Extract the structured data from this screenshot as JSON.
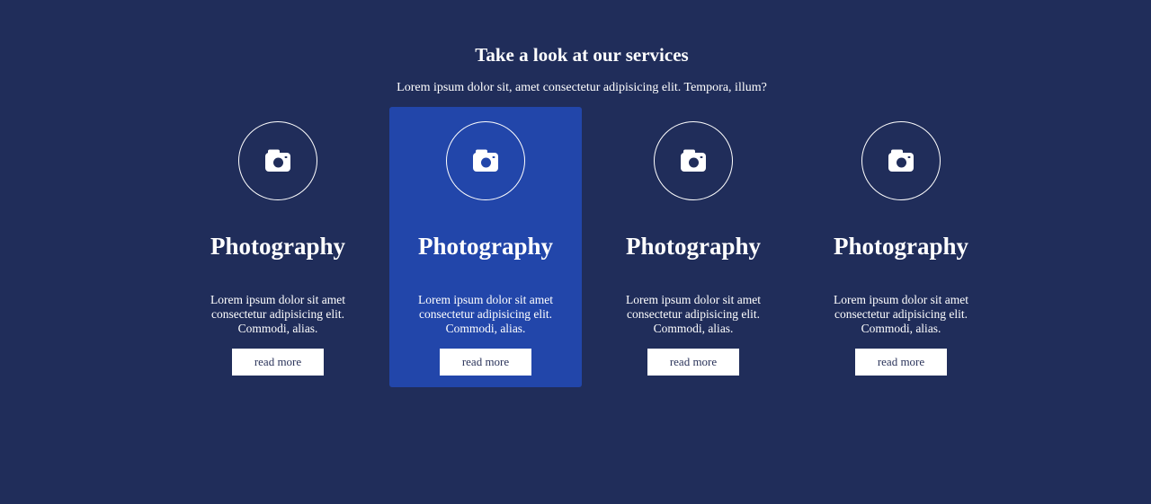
{
  "header": {
    "title": "Take a look at our services",
    "subtitle": "Lorem ipsum dolor sit, amet consectetur adipisicing elit. Tempora, illum?"
  },
  "cards": [
    {
      "icon": "camera-icon",
      "title": "Photography",
      "text": "Lorem ipsum dolor sit amet consectetur adipisicing elit. Commodi, alias.",
      "button": "read more"
    },
    {
      "icon": "camera-icon",
      "title": "Photography",
      "text": "Lorem ipsum dolor sit amet consectetur adipisicing elit. Commodi, alias.",
      "button": "read more"
    },
    {
      "icon": "camera-icon",
      "title": "Photography",
      "text": "Lorem ipsum dolor sit amet consectetur adipisicing elit. Commodi, alias.",
      "button": "read more"
    },
    {
      "icon": "camera-icon",
      "title": "Photography",
      "text": "Lorem ipsum dolor sit amet consectetur adipisicing elit. Commodi, alias.",
      "button": "read more"
    }
  ],
  "colors": {
    "background": "#202d5a",
    "highlight_card": "#2246aa",
    "button_background": "#ffffff",
    "button_text": "#2a335a"
  }
}
